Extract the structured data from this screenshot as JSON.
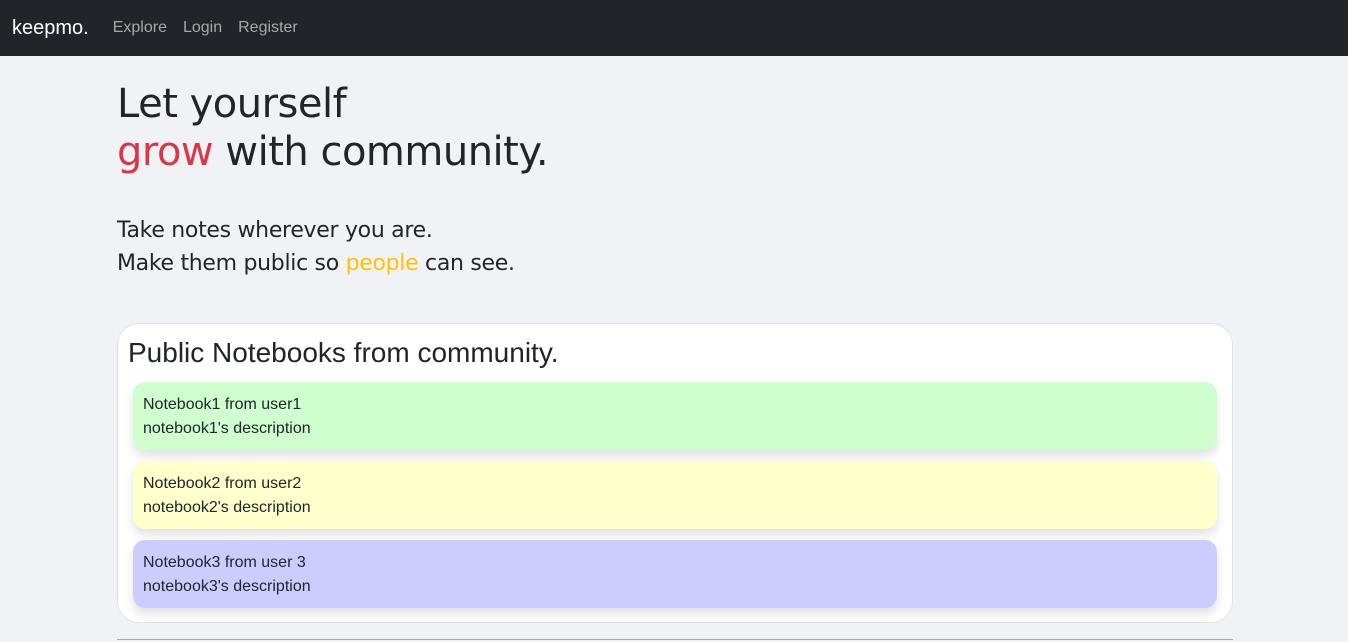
{
  "navbar": {
    "brand": "keepmo.",
    "links": [
      {
        "label": "Explore"
      },
      {
        "label": "Login"
      },
      {
        "label": "Register"
      }
    ]
  },
  "hero": {
    "line1": "Let yourself",
    "line2_accent": "grow",
    "line2_rest": " with community.",
    "sub_line1": "Take notes wherever you are.",
    "sub_line2_start": "Make them public so ",
    "sub_line2_accent": "people",
    "sub_line2_end": " can see."
  },
  "community": {
    "title": "Public Notebooks from community.",
    "notebooks": [
      {
        "title": "Notebook1 from user1",
        "description": "notebook1's description",
        "color": "#cfffcf"
      },
      {
        "title": "Notebook2 from user2",
        "description": "notebook2's description",
        "color": "#ffffcc"
      },
      {
        "title": "Notebook3 from user 3",
        "description": "notebook3's description",
        "color": "#ccccff"
      }
    ]
  },
  "colors": {
    "navbar_bg": "#212529",
    "accent_red": "#dc3545",
    "accent_yellow": "#ffc107",
    "page_bg": "#f1f2f6"
  }
}
